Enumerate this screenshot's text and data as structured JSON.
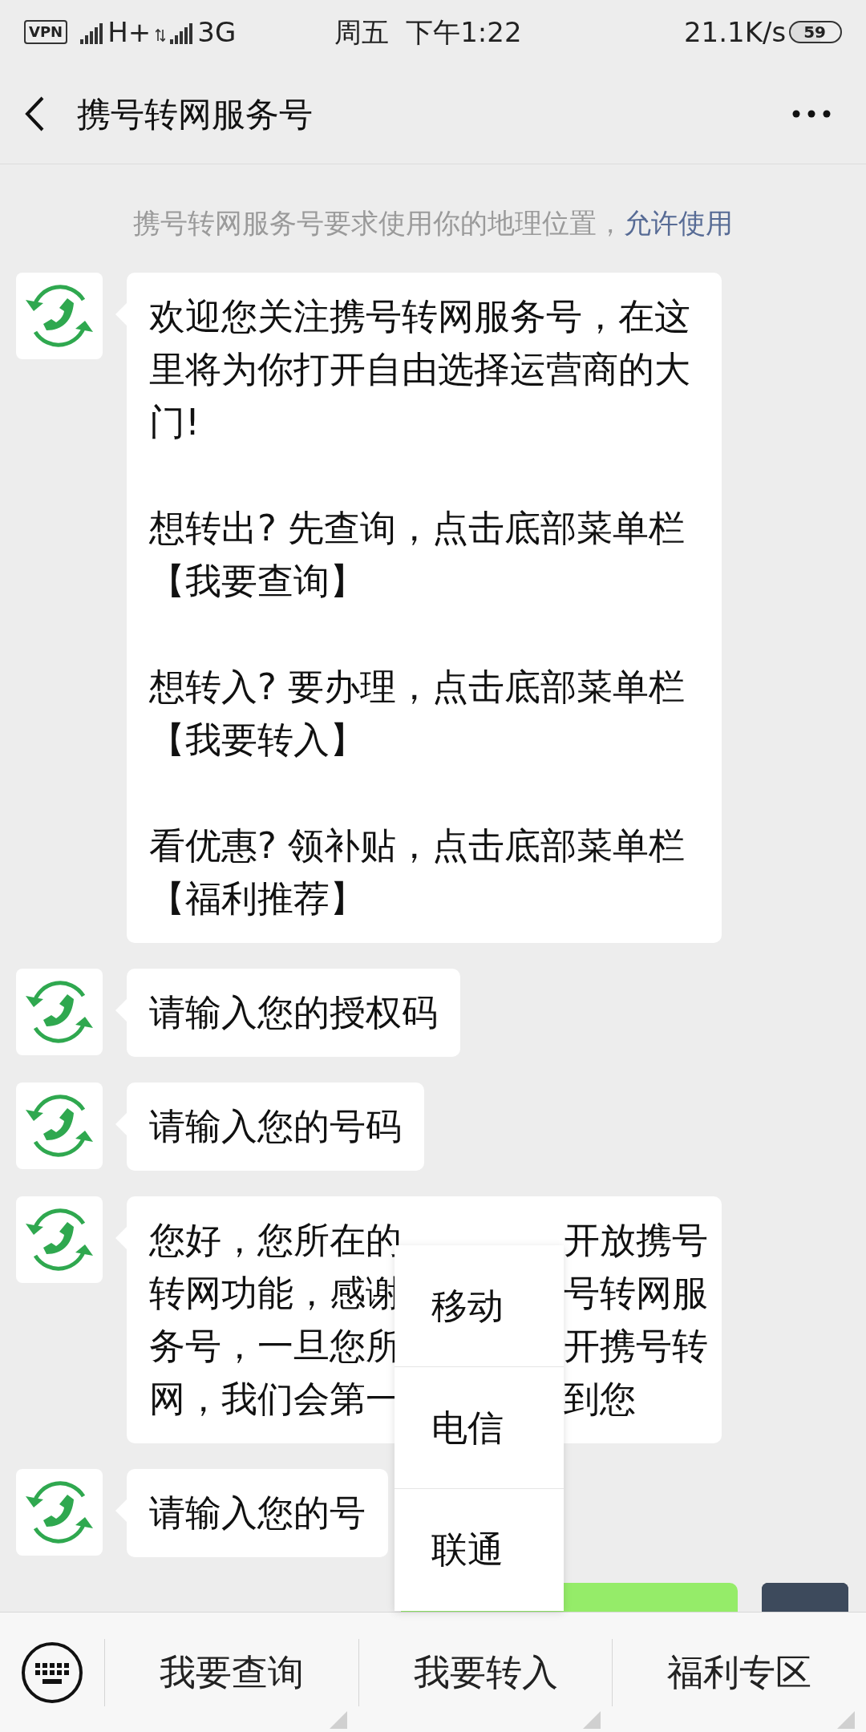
{
  "status_bar": {
    "vpn": "VPN",
    "network_1": "H+",
    "network_2": "3G",
    "day": "周五",
    "time": "下午1:22",
    "speed": "21.1K/s",
    "battery": "59"
  },
  "header": {
    "title": "携号转网服务号"
  },
  "notice": {
    "text": "携号转网服务号要求使用你的地理位置，",
    "link": "允许使用"
  },
  "messages": [
    {
      "kind": "text",
      "paragraphs": [
        "欢迎您关注携号转网服务号，在这里将为你打开自由选择运营商的大门!",
        "想转出? 先查询，点击底部菜单栏【我要查询】",
        "想转入? 要办理，点击底部菜单栏【我要转入】",
        "看优惠? 领补贴，点击底部菜单栏【福利推荐】"
      ]
    },
    {
      "kind": "text",
      "paragraphs": [
        "请输入您的授权码"
      ]
    },
    {
      "kind": "text",
      "paragraphs": [
        "请输入您的号码"
      ]
    },
    {
      "kind": "split",
      "lines": [
        {
          "left": "您好，您所在的",
          "right": "开放携号"
        },
        {
          "left": "转网功能，感谢",
          "right": "号转网服"
        },
        {
          "left": "务号，一旦您所",
          "right": "开携号转"
        },
        {
          "left": "网，我们会第一",
          "right": "到您"
        }
      ]
    },
    {
      "kind": "text",
      "paragraphs": [
        "请输入您的号"
      ]
    },
    {
      "kind": "outgoing"
    }
  ],
  "popup_menu": {
    "items": [
      "移动",
      "电信",
      "联通"
    ]
  },
  "bottom_menu": {
    "items": [
      "我要查询",
      "我要转入",
      "福利专区"
    ]
  }
}
